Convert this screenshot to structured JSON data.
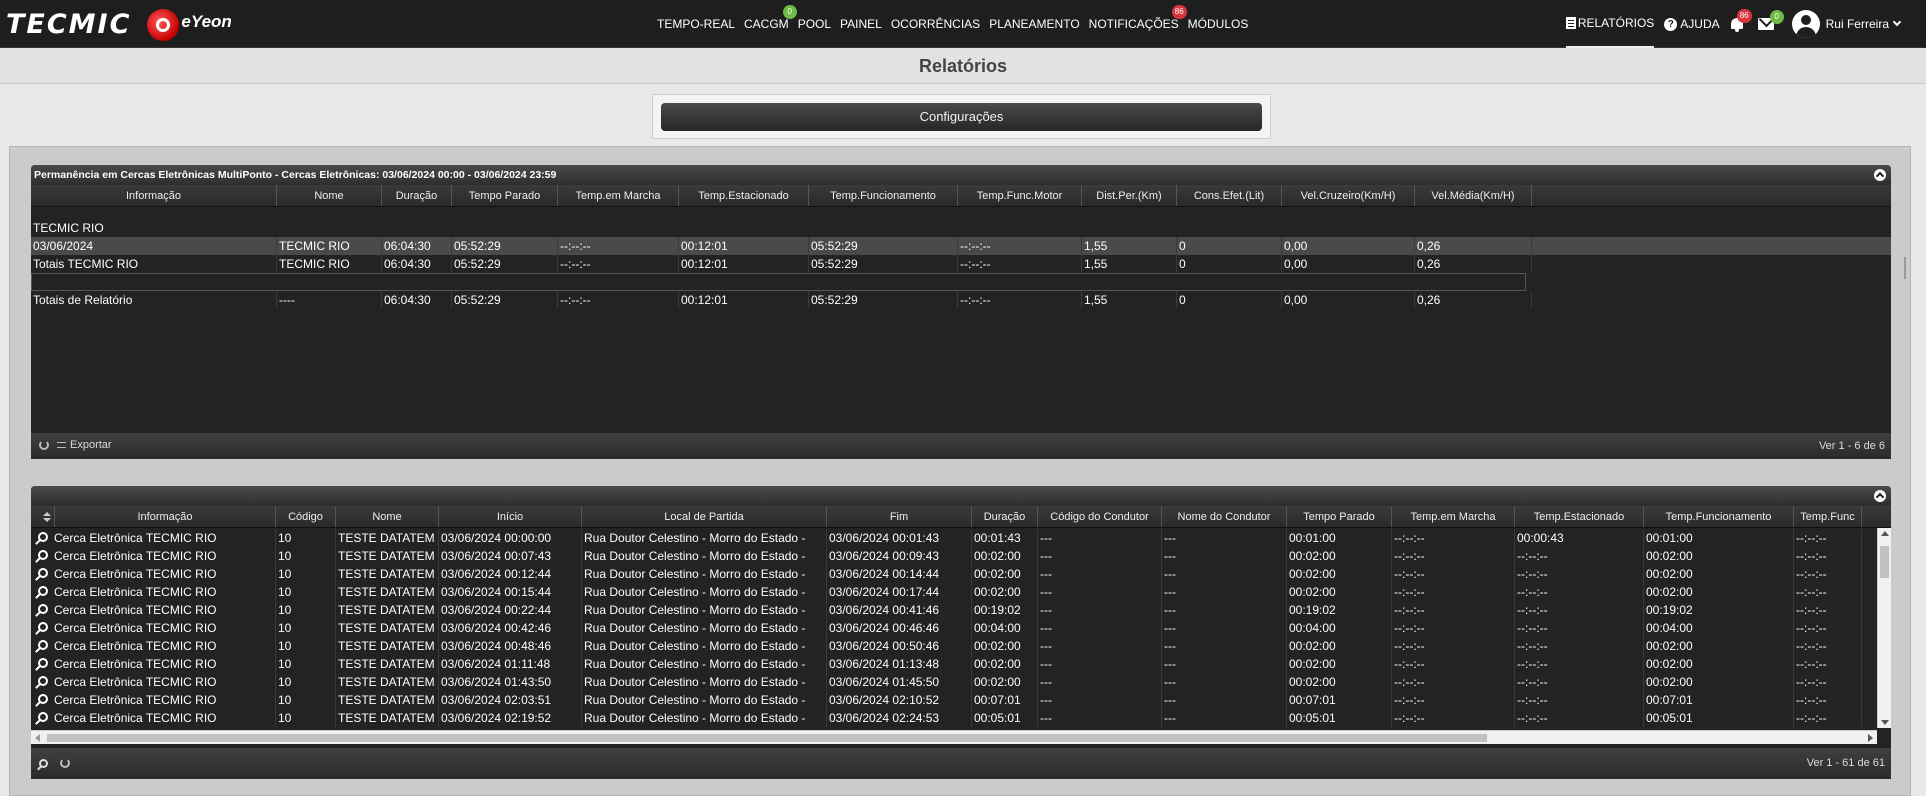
{
  "brand": {
    "primary": "TECMIC",
    "secondary": "eYeon"
  },
  "nav": {
    "items": [
      {
        "label": "TEMPO-REAL",
        "badge": ""
      },
      {
        "label": "CACGM",
        "badge": "0",
        "badge_color": "green"
      },
      {
        "label": "POOL",
        "badge": ""
      },
      {
        "label": "PAINEL",
        "badge": ""
      },
      {
        "label": "OCORRÊNCIAS",
        "badge": ""
      },
      {
        "label": "PLANEAMENTO",
        "badge": ""
      },
      {
        "label": "NOTIFICAÇÕES",
        "badge": "86",
        "badge_color": "red"
      },
      {
        "label": "MÓDULOS",
        "badge": ""
      }
    ],
    "reports_label": "RELATÓRIOS",
    "help_label": "AJUDA",
    "bell_badge": "86",
    "mail_badge": "0",
    "user_name": "Rui Ferreira"
  },
  "page": {
    "title": "Relatórios",
    "config_button": "Configurações"
  },
  "summary": {
    "title": "Permanência em Cercas Eletrônicas MultiPonto - Cercas Eletrônicas: 03/06/2024 00:00 - 03/06/2024 23:59",
    "columns": [
      "Informação",
      "Nome",
      "Duração",
      "Tempo Parado",
      "Temp.em Marcha",
      "Temp.Estacionado",
      "Temp.Funcionamento",
      "Temp.Func.Motor",
      "Dist.Per.(Km)",
      "Cons.Efet.(Lit)",
      "Vel.Cruzeiro(Km/H)",
      "Vel.Média(Km/H)"
    ],
    "group_label": "TECMIC RIO",
    "rows": [
      [
        "03/06/2024",
        "TECMIC RIO",
        "06:04:30",
        "05:52:29",
        "--:--:--",
        "00:12:01",
        "05:52:29",
        "--:--:--",
        "1,55",
        "0",
        "0,00",
        "0,26"
      ],
      [
        "Totais TECMIC RIO",
        "TECMIC RIO",
        "06:04:30",
        "05:52:29",
        "--:--:--",
        "00:12:01",
        "05:52:29",
        "--:--:--",
        "1,55",
        "0",
        "0,00",
        "0,26"
      ]
    ],
    "totals": [
      "Totais de Relatório",
      "----",
      "06:04:30",
      "05:52:29",
      "--:--:--",
      "00:12:01",
      "05:52:29",
      "--:--:--",
      "1,55",
      "0",
      "0,00",
      "0,26"
    ],
    "export_label": "Exportar",
    "pager": "Ver 1 - 6 de 6"
  },
  "detail": {
    "columns": [
      "Informação",
      "Código",
      "Nome",
      "Início",
      "Local de Partida",
      "Fim",
      "Duração",
      "Código do Condutor",
      "Nome do Condutor",
      "Tempo Parado",
      "Temp.em Marcha",
      "Temp.Estacionado",
      "Temp.Funcionamento",
      "Temp.Func"
    ],
    "rows": [
      [
        "Cerca Eletrônica TECMIC RIO",
        "10",
        "TESTE DATATEM - ",
        "03/06/2024 00:00:00",
        "Rua Doutor Celestino - Morro do Estado - ",
        "03/06/2024 00:01:43",
        "00:01:43",
        "---",
        "---",
        "00:01:00",
        "--:--:--",
        "00:00:43",
        "00:01:00",
        "--:--:--"
      ],
      [
        "Cerca Eletrônica TECMIC RIO",
        "10",
        "TESTE DATATEM - ",
        "03/06/2024 00:07:43",
        "Rua Doutor Celestino - Morro do Estado - ",
        "03/06/2024 00:09:43",
        "00:02:00",
        "---",
        "---",
        "00:02:00",
        "--:--:--",
        "--:--:--",
        "00:02:00",
        "--:--:--"
      ],
      [
        "Cerca Eletrônica TECMIC RIO",
        "10",
        "TESTE DATATEM - ",
        "03/06/2024 00:12:44",
        "Rua Doutor Celestino - Morro do Estado - ",
        "03/06/2024 00:14:44",
        "00:02:00",
        "---",
        "---",
        "00:02:00",
        "--:--:--",
        "--:--:--",
        "00:02:00",
        "--:--:--"
      ],
      [
        "Cerca Eletrônica TECMIC RIO",
        "10",
        "TESTE DATATEM - ",
        "03/06/2024 00:15:44",
        "Rua Doutor Celestino - Morro do Estado - ",
        "03/06/2024 00:17:44",
        "00:02:00",
        "---",
        "---",
        "00:02:00",
        "--:--:--",
        "--:--:--",
        "00:02:00",
        "--:--:--"
      ],
      [
        "Cerca Eletrônica TECMIC RIO",
        "10",
        "TESTE DATATEM - ",
        "03/06/2024 00:22:44",
        "Rua Doutor Celestino - Morro do Estado - ",
        "03/06/2024 00:41:46",
        "00:19:02",
        "---",
        "---",
        "00:19:02",
        "--:--:--",
        "--:--:--",
        "00:19:02",
        "--:--:--"
      ],
      [
        "Cerca Eletrônica TECMIC RIO",
        "10",
        "TESTE DATATEM - ",
        "03/06/2024 00:42:46",
        "Rua Doutor Celestino - Morro do Estado - ",
        "03/06/2024 00:46:46",
        "00:04:00",
        "---",
        "---",
        "00:04:00",
        "--:--:--",
        "--:--:--",
        "00:04:00",
        "--:--:--"
      ],
      [
        "Cerca Eletrônica TECMIC RIO",
        "10",
        "TESTE DATATEM - ",
        "03/06/2024 00:48:46",
        "Rua Doutor Celestino - Morro do Estado - ",
        "03/06/2024 00:50:46",
        "00:02:00",
        "---",
        "---",
        "00:02:00",
        "--:--:--",
        "--:--:--",
        "00:02:00",
        "--:--:--"
      ],
      [
        "Cerca Eletrônica TECMIC RIO",
        "10",
        "TESTE DATATEM - ",
        "03/06/2024 01:11:48",
        "Rua Doutor Celestino - Morro do Estado - ",
        "03/06/2024 01:13:48",
        "00:02:00",
        "---",
        "---",
        "00:02:00",
        "--:--:--",
        "--:--:--",
        "00:02:00",
        "--:--:--"
      ],
      [
        "Cerca Eletrônica TECMIC RIO",
        "10",
        "TESTE DATATEM - ",
        "03/06/2024 01:43:50",
        "Rua Doutor Celestino - Morro do Estado - ",
        "03/06/2024 01:45:50",
        "00:02:00",
        "---",
        "---",
        "00:02:00",
        "--:--:--",
        "--:--:--",
        "00:02:00",
        "--:--:--"
      ],
      [
        "Cerca Eletrônica TECMIC RIO",
        "10",
        "TESTE DATATEM - ",
        "03/06/2024 02:03:51",
        "Rua Doutor Celestino - Morro do Estado - ",
        "03/06/2024 02:10:52",
        "00:07:01",
        "---",
        "---",
        "00:07:01",
        "--:--:--",
        "--:--:--",
        "00:07:01",
        "--:--:--"
      ],
      [
        "Cerca Eletrônica TECMIC RIO",
        "10",
        "TESTE DATATEM - ",
        "03/06/2024 02:19:52",
        "Rua Doutor Celestino - Morro do Estado - ",
        "03/06/2024 02:24:53",
        "00:05:01",
        "---",
        "---",
        "00:05:01",
        "--:--:--",
        "--:--:--",
        "00:05:01",
        "--:--:--"
      ]
    ],
    "pager": "Ver 1 - 61 de 61"
  }
}
